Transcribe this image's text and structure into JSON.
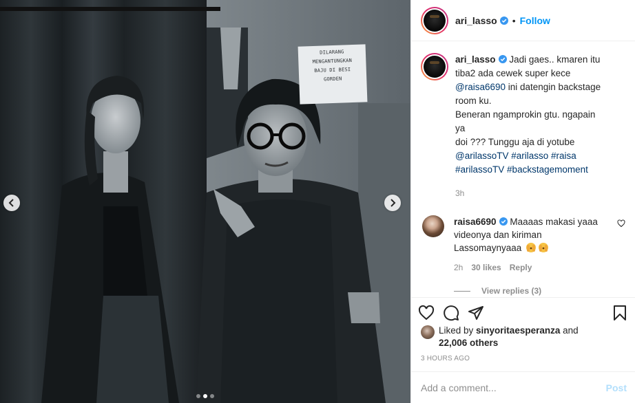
{
  "header": {
    "username": "ari_lasso",
    "follow_separator": "•",
    "follow_label": "Follow"
  },
  "media": {
    "sign_lines": [
      "DILARANG",
      "MENGANTUNGKAN",
      "BAJU DI BESI",
      "GORDEN"
    ],
    "image_count": 3,
    "active_index": 1
  },
  "caption": {
    "username": "ari_lasso",
    "line1": "Jadi gaes.. kmaren itu",
    "line2": "tiba2 ada cewek super kece",
    "mention": "@raisa6690",
    "line3_rest": " ini datengin backstage",
    "line4": "room ku.",
    "line5": "Beneran ngamprokin gtu. ngapain ya",
    "line6": "doi ??? Tunggu aja di yotube",
    "tag1": "@arilassoTV",
    "tag2": "#arilasso",
    "tag3": "#raisa",
    "tag4": "#arilassoTV",
    "tag5": "#backstagemoment",
    "time": "3h"
  },
  "comment": {
    "username": "raisa6690",
    "text_line1": "Maaaas makasi yaaa",
    "text_line2": "videonya dan kiriman",
    "text_line3": "Lassomaynyaaa",
    "time": "2h",
    "likes": "30 likes",
    "reply_label": "Reply",
    "view_replies": "View replies (3)"
  },
  "likes": {
    "prefix": "Liked by ",
    "liker": "sinyoritaesperanza",
    "and": " and",
    "others": "22,006 others"
  },
  "post_time": "3 HOURS AGO",
  "add_comment": {
    "placeholder": "Add a comment...",
    "post_label": "Post"
  },
  "colors": {
    "accent": "#0095f6",
    "link": "#00376b",
    "muted": "#8e8e8e",
    "post_disabled": "#b2dffc"
  }
}
